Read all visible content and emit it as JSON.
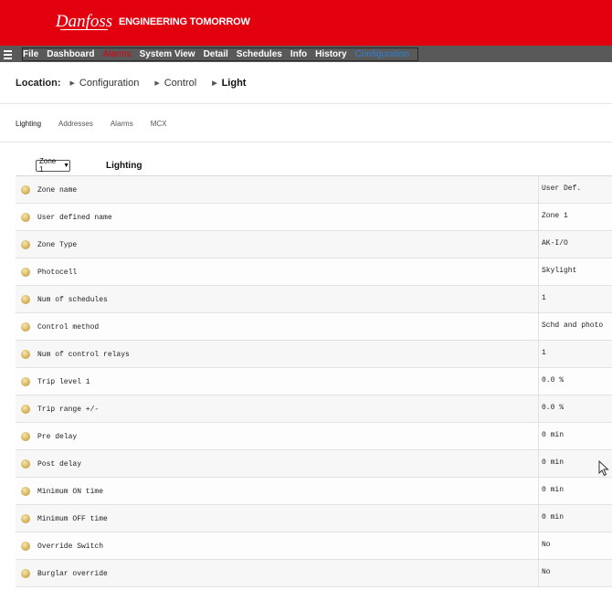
{
  "brand": {
    "logo_text": "Danfoss",
    "tagline": "ENGINEERING TOMORROW",
    "color": "#e2000f"
  },
  "menu": {
    "items": [
      {
        "label": "File"
      },
      {
        "label": "Dashboard"
      },
      {
        "label": "Alarms"
      },
      {
        "label": "System View"
      },
      {
        "label": "Detail"
      },
      {
        "label": "Schedules"
      },
      {
        "label": "Info"
      },
      {
        "label": "History"
      },
      {
        "label": "Configuration"
      }
    ]
  },
  "location": {
    "label": "Location:",
    "crumbs": [
      "Configuration",
      "Control",
      "Light"
    ]
  },
  "tabs": [
    "Lighting",
    "Addresses",
    "Alarms",
    "MCX"
  ],
  "panel": {
    "zone_select": "Zone 1",
    "title": "Lighting"
  },
  "rows": [
    {
      "name": "Zone name",
      "value": "User Def."
    },
    {
      "name": "User defined name",
      "value": "Zone 1"
    },
    {
      "name": "Zone Type",
      "value": "AK-I/O"
    },
    {
      "name": "Photocell",
      "value": "Skylight"
    },
    {
      "name": "Num of schedules",
      "value": "1"
    },
    {
      "name": "Control method",
      "value": "Schd and photo"
    },
    {
      "name": "Num of control relays",
      "value": "1"
    },
    {
      "name": "Trip level 1",
      "value": "0.0 %"
    },
    {
      "name": "Trip range +/-",
      "value": "0.0 %"
    },
    {
      "name": "Pre delay",
      "value": "0 min"
    },
    {
      "name": "Post delay",
      "value": "0 min"
    },
    {
      "name": "Minimum ON time",
      "value": "0 min"
    },
    {
      "name": "Minimum OFF time",
      "value": "0 min"
    },
    {
      "name": "Override Switch",
      "value": "No"
    },
    {
      "name": "Burglar override",
      "value": "No"
    }
  ]
}
